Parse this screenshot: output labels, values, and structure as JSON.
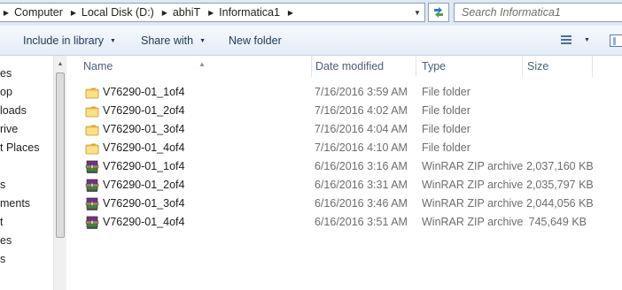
{
  "address": {
    "crumbs": [
      "Computer",
      "Local Disk (D:)",
      "abhiT",
      "Informatica1"
    ],
    "search_placeholder": "Search Informatica1"
  },
  "toolbar": {
    "include_label": "Include in library",
    "share_label": "Share with",
    "new_folder_label": "New folder"
  },
  "nav": {
    "items": [
      "es",
      "op",
      "loads",
      "rive",
      "t Places",
      "s",
      "ments",
      "t",
      "es",
      "s"
    ]
  },
  "columns": {
    "name": "Name",
    "date": "Date modified",
    "type": "Type",
    "size": "Size"
  },
  "files": [
    {
      "name": "V76290-01_1of4",
      "date": "7/16/2016 3:59 AM",
      "type": "File folder",
      "size": "",
      "icon": "folder-icon"
    },
    {
      "name": "V76290-01_2of4",
      "date": "7/16/2016 4:02 AM",
      "type": "File folder",
      "size": "",
      "icon": "folder-icon"
    },
    {
      "name": "V76290-01_3of4",
      "date": "7/16/2016 4:04 AM",
      "type": "File folder",
      "size": "",
      "icon": "folder-icon"
    },
    {
      "name": "V76290-01_4of4",
      "date": "7/16/2016 4:10 AM",
      "type": "File folder",
      "size": "",
      "icon": "folder-icon"
    },
    {
      "name": "V76290-01_1of4",
      "date": "6/16/2016 3:16 AM",
      "type": "WinRAR ZIP archive",
      "size": "2,037,160 KB",
      "icon": "winrar-archive-icon"
    },
    {
      "name": "V76290-01_2of4",
      "date": "6/16/2016 3:31 AM",
      "type": "WinRAR ZIP archive",
      "size": "2,035,797 KB",
      "icon": "winrar-archive-icon"
    },
    {
      "name": "V76290-01_3of4",
      "date": "6/16/2016 3:46 AM",
      "type": "WinRAR ZIP archive",
      "size": "2,044,056 KB",
      "icon": "winrar-archive-icon"
    },
    {
      "name": "V76290-01_4of4",
      "date": "6/16/2016 3:51 AM",
      "type": "WinRAR ZIP archive",
      "size": "745,649 KB",
      "icon": "winrar-archive-icon"
    }
  ]
}
